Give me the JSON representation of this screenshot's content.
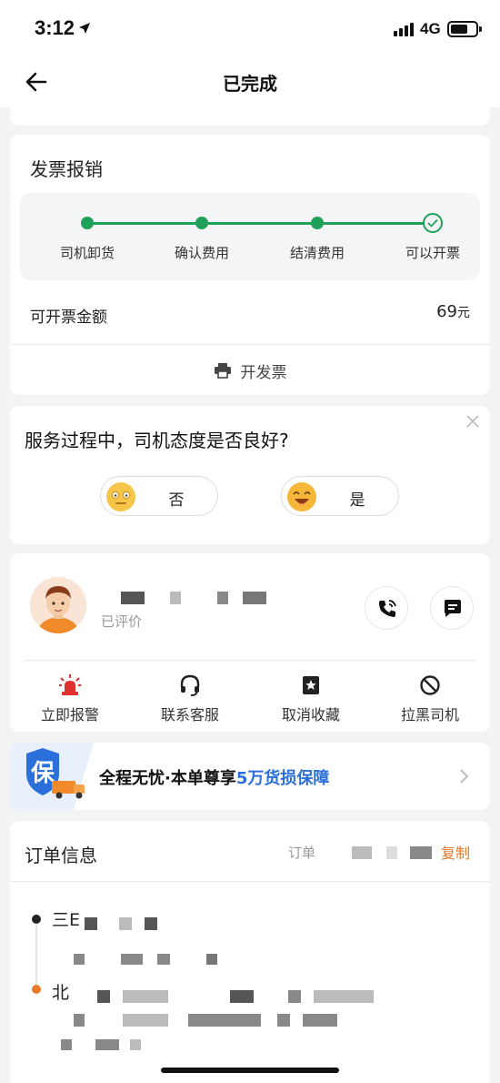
{
  "status": {
    "time": "3:12",
    "network": "4G"
  },
  "nav": {
    "title": "已完成"
  },
  "invoice": {
    "title": "发票报销",
    "steps": [
      "司机卸货",
      "确认费用",
      "结清费用",
      "可以开票"
    ],
    "amount_label": "可开票金额",
    "amount_value": "69",
    "amount_unit": "元",
    "action_label": "开发票"
  },
  "survey": {
    "question": "服务过程中，司机态度是否良好?",
    "options": [
      "否",
      "是"
    ]
  },
  "driver": {
    "rated_text": "已评价",
    "actions": [
      "立即报警",
      "联系客服",
      "取消收藏",
      "拉黑司机"
    ]
  },
  "banner": {
    "badge": "保",
    "text_prefix": "全程无忧·本单尊享",
    "text_highlight": "5万货损保障"
  },
  "order": {
    "title": "订单信息",
    "order_no_label": "订单",
    "copy_label": "复制",
    "from_prefix": "三E",
    "to_prefix": "北"
  },
  "colors": {
    "accent_green": "#20a159",
    "accent_orange": "#e87a2a",
    "accent_blue": "#2b6fdb"
  }
}
